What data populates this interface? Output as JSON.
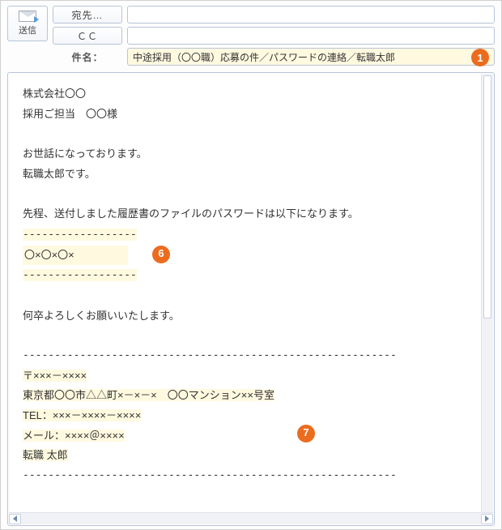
{
  "header": {
    "send_label": "送信",
    "to_button": "宛先…",
    "cc_button": "ＣＣ",
    "subject_label": "件名：",
    "to_value": "",
    "cc_value": "",
    "subject_value": "中途採用（〇〇職）応募の件／パスワードの連絡／転職太郎"
  },
  "badges": {
    "subject": "1",
    "password": "6",
    "signature": "7"
  },
  "body": {
    "line1": "株式会社〇〇",
    "line2": "採用ご担当　〇〇様",
    "line3": "お世話になっております。",
    "line4": "転職太郎です。",
    "line5": "先程、送付しました履歴書のファイルのパスワードは以下になります。",
    "dash_short": "------------------",
    "password": "〇×〇×〇×",
    "line6": "何卒よろしくお願いいたします。",
    "dash_long": "-----------------------------------------------------------",
    "sig1": "〒×××－××××",
    "sig2": "東京都〇〇市△△町×－×－×　〇〇マンション××号室",
    "sig3": "TEL：×××－××××－××××",
    "sig4": "メール：××××＠××××",
    "sig5": "転職  太郎"
  }
}
